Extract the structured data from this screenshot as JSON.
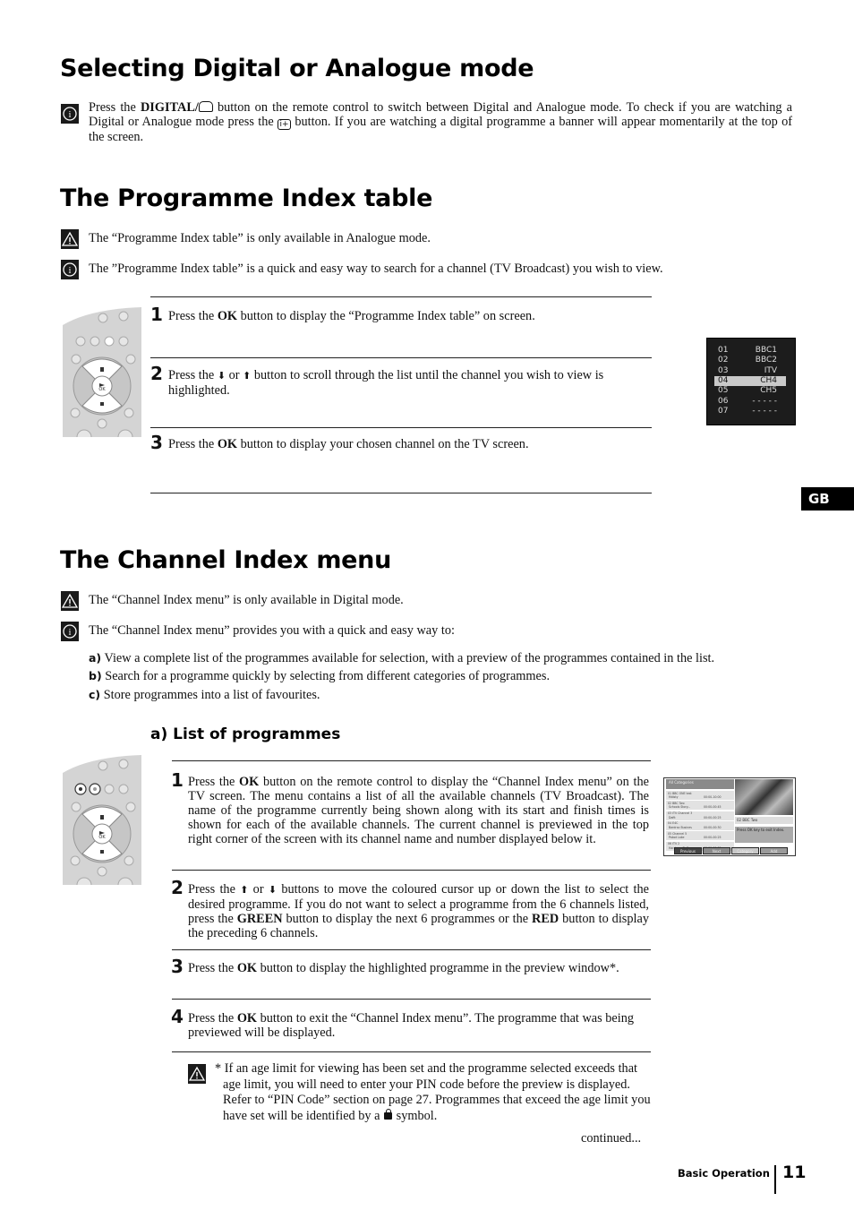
{
  "sections": {
    "digital_analogue": {
      "title": "Selecting Digital or Analogue mode",
      "info_p1": "Press the ",
      "info_bold": "DIGITAL/",
      "info_p2": " button on the remote control to switch between Digital and Analogue mode. To check if you are watching a Digital or Analogue mode press the ",
      "info_p3": " button. If you are watching a digital programme a banner will appear momentarily at the top of the screen."
    },
    "programme_index": {
      "title": "The Programme Index table",
      "warning": "The “Programme Index table” is only available in Analogue mode.",
      "info": "The ”Programme Index table” is a quick and easy way to search for a channel (TV Broadcast) you wish to view.",
      "steps": [
        {
          "num": "1",
          "pre": "Press the ",
          "bold": "OK",
          "post": " button to display the “Programme Index table” on screen."
        },
        {
          "num": "2",
          "pre": "Press the ",
          "arrow1": "⬇",
          "mid": " or ",
          "arrow2": "⬆",
          "post": " button to scroll through the list until the channel you wish to view is highlighted."
        },
        {
          "num": "3",
          "pre": "Press the ",
          "bold": "OK",
          "post": " button to display your chosen channel on the TV screen."
        }
      ],
      "osd_table": [
        {
          "num": "01",
          "channel": "BBC1",
          "highlighted": false
        },
        {
          "num": "02",
          "channel": "BBC2",
          "highlighted": false
        },
        {
          "num": "03",
          "channel": "ITV",
          "highlighted": false
        },
        {
          "num": "04",
          "channel": "CH4",
          "highlighted": true
        },
        {
          "num": "05",
          "channel": "CH5",
          "highlighted": false
        },
        {
          "num": "06",
          "channel": "- - - - -",
          "highlighted": false
        },
        {
          "num": "07",
          "channel": "- - - - -",
          "highlighted": false
        }
      ]
    },
    "channel_index": {
      "title": "The Channel Index menu",
      "warning": "The “Channel Index menu” is only available in Digital mode.",
      "info": "The “Channel Index menu” provides you with a quick and easy way to:",
      "list": [
        {
          "label": "a)",
          "text": "View a complete list of the programmes available for selection, with a preview of the programmes contained in the list."
        },
        {
          "label": "b)",
          "text": "Search for a programme quickly by selecting from different categories of programmes."
        },
        {
          "label": "c)",
          "text": "Store programmes into a list of favourites."
        }
      ],
      "subheading": "a) List of programmes",
      "steps": [
        {
          "num": "1",
          "pre": "Press the ",
          "bold": "OK",
          "post": " button on the remote control to display the “Channel Index menu” on the TV screen. The menu contains a list of all the available channels (TV Broadcast). The name of the programme currently being shown along with its start and finish times is shown for each of the available channels. The current channel is previewed in the top right corner of the screen with its channel name and number displayed below it."
        },
        {
          "num": "2",
          "pre": "Press the ",
          "arrow1": "⬆",
          "mid": " or ",
          "arrow2": "⬇",
          "post_a": " buttons to move the coloured cursor up or down the list to select the desired programme. If you do not want to select a programme from the 6 channels listed, press the ",
          "bold_green": "GREEN",
          "post_b": " button to display the next 6 programmes or the ",
          "bold_red": "RED",
          "post_c": " button to display the preceding 6 channels."
        },
        {
          "num": "3",
          "pre": "Press the ",
          "bold": "OK",
          "post": " button to display the highlighted programme in the preview window*."
        },
        {
          "num": "4",
          "pre": "Press the ",
          "bold": "OK",
          "post": " button to exit the “Channel Index menu”. The programme that was being previewed will be displayed."
        }
      ],
      "footnote_pre": "* If an age limit for viewing has been set and the programme selected exceeds that age limit, you will need to enter your PIN code before the preview is displayed. Refer to “PIN Code” section on page 27. Programmes that exceed the age limit you have set will be identified by a ",
      "footnote_post": " symbol.",
      "continued": "continued...",
      "tv_screen": {
        "header": "All Categories",
        "channels": [
          {
            "name": "01 BBC ONE test",
            "programme": "Mdisty",
            "time": "00:00-10:00"
          },
          {
            "name": "02 BBC Two",
            "programme": "Schools Story...",
            "time": "00:00-00:45"
          },
          {
            "name": "03 ITV Channel 3",
            "programme": "Dafit",
            "time": "00:00-00:25"
          },
          {
            "name": "04 E4C",
            "programme": "Bardrac Busines",
            "time": "00:00-00:30"
          },
          {
            "name": "05 Channel 5",
            "programme": "Pabot Lake",
            "time": "00:00-00:25"
          },
          {
            "name": "06 ITV 2",
            "programme": "Hardover To B...",
            "time": "00:00-00:05"
          }
        ],
        "preview_channel": "02 BBC Two",
        "preview_message": "Press OK key to exit Index.",
        "buttons": [
          "Previous",
          "Next",
          "Category",
          "Add"
        ]
      }
    }
  },
  "side_tab": "GB",
  "footer": {
    "section": "Basic Operation",
    "page": "11"
  },
  "remote": {
    "ok_label": "OK"
  },
  "colors": {
    "tv_btn_previous": "#444444",
    "tv_btn_next": "#8a8a8a",
    "tv_btn_category": "#c8c8c8",
    "tv_btn_add": "#9a9a9a",
    "osd_bg": "#1c1c1c",
    "osd_highlight": "#c9c9c9"
  }
}
